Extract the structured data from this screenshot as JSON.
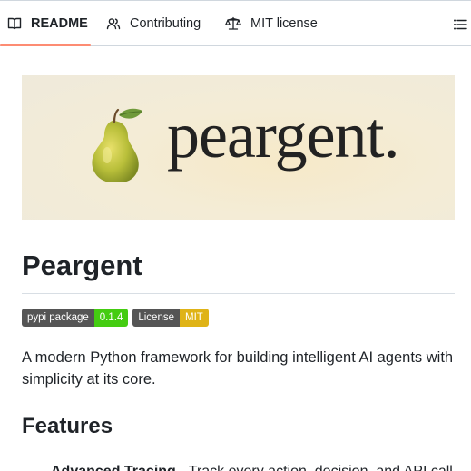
{
  "tabs": [
    {
      "label": "README",
      "icon": "book-icon",
      "active": true
    },
    {
      "label": "Contributing",
      "icon": "people-icon",
      "active": false
    },
    {
      "label": "MIT license",
      "icon": "law-scale-icon",
      "active": false
    }
  ],
  "toc_icon": "list-unordered-icon",
  "banner": {
    "wordmark": "peargent.",
    "icon": "pear-icon"
  },
  "readme": {
    "title": "Peargent",
    "badges": [
      {
        "label": "pypi package",
        "value": "0.1.4",
        "color": "#4c1"
      },
      {
        "label": "License",
        "value": "MIT",
        "color": "#dfb317"
      }
    ],
    "description": "A modern Python framework for building intelligent AI agents with simplicity at its core.",
    "features_heading": "Features",
    "features": [
      {
        "name": "Advanced Tracing",
        "text": " - Track every action, decision, and API call"
      }
    ]
  },
  "colors": {
    "active_tab_underline": "#fd8c73",
    "text": "#1f2328",
    "border": "#d0d7de"
  }
}
